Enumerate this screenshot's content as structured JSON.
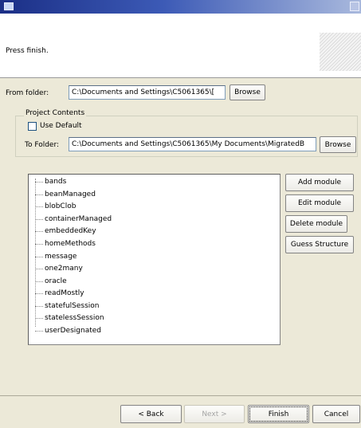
{
  "banner": {
    "message": "Press finish."
  },
  "from_folder": {
    "label": "From folder:",
    "value": "C:\\Documents and Settings\\C5061365\\[",
    "browse_label": "Browse"
  },
  "project_contents": {
    "title": "Project Contents",
    "use_default_label": "Use Default",
    "use_default_checked": false,
    "to_folder_label": "To Folder:",
    "to_folder_value": "C:\\Documents and Settings\\C5061365\\My Documents\\MigratedB",
    "browse_label": "Browse"
  },
  "modules": {
    "items": [
      "bands",
      "beanManaged",
      "blobClob",
      "containerManaged",
      "embeddedKey",
      "homeMethods",
      "message",
      "one2many",
      "oracle",
      "readMostly",
      "statefulSession",
      "statelessSession",
      "userDesignated"
    ],
    "add_label": "Add module",
    "edit_label": "Edit module",
    "delete_label": "Delete module",
    "guess_label": "Guess Structure"
  },
  "footer": {
    "back_label": "< Back",
    "next_label": "Next >",
    "finish_label": "Finish",
    "cancel_label": "Cancel"
  },
  "colors": {
    "title_bar_start": "#1b2f86",
    "title_bar_end": "#a9b9dd",
    "dialog_background": "#ece9d8"
  },
  "icons": {
    "window": "window-icon",
    "close": "close-icon"
  }
}
